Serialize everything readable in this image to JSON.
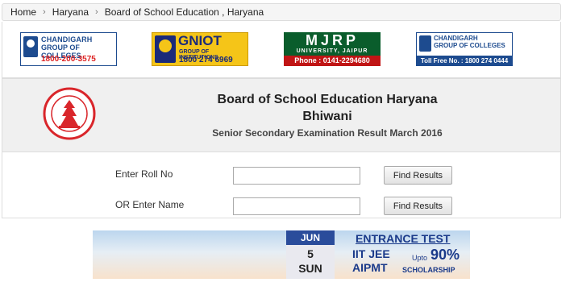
{
  "breadcrumb": {
    "items": [
      "Home",
      "Haryana",
      "Board of School Education , Haryana"
    ],
    "separator": "›"
  },
  "ads": {
    "cgc_left": {
      "line1": "CHANDIGARH",
      "line2": "GROUP OF COLLEGES",
      "phone": "1800-200-3575",
      "brand_color": "#1d4b8f"
    },
    "gniot": {
      "name": "GNIOT",
      "subtitle": "GROUP OF INSTITUTIONS",
      "phone": "1800 274 6969",
      "brand_color": "#f5c518"
    },
    "mjrp": {
      "name": "MJRP",
      "subtitle": "UNIVERSITY, JAIPUR",
      "phone": "Phone : 0141-2294680",
      "brand_color": "#0a5d2c"
    },
    "cgc_right": {
      "line1": "CHANDIGARH",
      "line2": "GROUP OF COLLEGES",
      "phone": "Toll Free No. : 1800 274 0444",
      "brand_color": "#1d4b8f"
    }
  },
  "board": {
    "title": "Board of School Education Haryana",
    "city": "Bhiwani",
    "exam": "Senior Secondary Examination Result March 2016",
    "seal_icon": "board-seal-icon"
  },
  "form": {
    "roll_label": "Enter Roll No",
    "roll_value": "",
    "name_label": "OR Enter Name",
    "name_value": "",
    "button_label": "Find Results"
  },
  "banner": {
    "month": "JUN",
    "day": "5",
    "weekday": "SUN",
    "heading": "ENTRANCE TEST",
    "line1": "IIT JEE",
    "line2": "AIPMT",
    "upto": "Upto",
    "percent": "90%",
    "scholarship": "SCHOLARSHIP",
    "accent_color": "#1a3a8a"
  }
}
